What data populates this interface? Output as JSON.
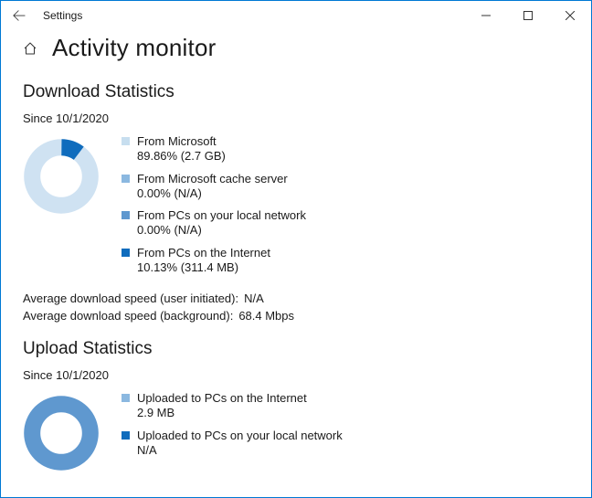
{
  "window": {
    "title": "Settings"
  },
  "page": {
    "title": "Activity monitor"
  },
  "colors": {
    "microsoft": "#c7deef",
    "cache": "#8bb8e0",
    "local": "#5f98cf",
    "internet": "#0f6cbd",
    "donut_track": "#cfe2f2",
    "donut_dark": "#0f6cbd",
    "donut_mid": "#5f98cf"
  },
  "download": {
    "section_title": "Download Statistics",
    "since": "Since 10/1/2020",
    "items": [
      {
        "label": "From Microsoft",
        "value": "89.86%  (2.7 GB)",
        "sw": "microsoft"
      },
      {
        "label": "From Microsoft cache server",
        "value": "0.00%  (N/A)",
        "sw": "cache"
      },
      {
        "label": "From PCs on your local network",
        "value": "0.00%  (N/A)",
        "sw": "local"
      },
      {
        "label": "From PCs on the Internet",
        "value": "10.13%  (311.4 MB)",
        "sw": "internet"
      }
    ],
    "avg_user_label": "Average download speed (user initiated):",
    "avg_user_value": "N/A",
    "avg_bg_label": "Average download speed (background):",
    "avg_bg_value": "68.4 Mbps"
  },
  "upload": {
    "section_title": "Upload Statistics",
    "since": "Since 10/1/2020",
    "items": [
      {
        "label": "Uploaded to PCs on the Internet",
        "value": "2.9 MB",
        "sw": "cache"
      },
      {
        "label": "Uploaded to PCs on your local network",
        "value": "N/A",
        "sw": "internet"
      }
    ]
  },
  "chart_data": [
    {
      "type": "pie",
      "title": "Download Sources",
      "series": [
        {
          "name": "From Microsoft",
          "value": 89.86,
          "size": "2.7 GB"
        },
        {
          "name": "From Microsoft cache server",
          "value": 0.0,
          "size": "N/A"
        },
        {
          "name": "From PCs on your local network",
          "value": 0.0,
          "size": "N/A"
        },
        {
          "name": "From PCs on the Internet",
          "value": 10.13,
          "size": "311.4 MB"
        }
      ]
    },
    {
      "type": "pie",
      "title": "Upload Destinations",
      "series": [
        {
          "name": "Uploaded to PCs on the Internet",
          "value": 100,
          "size": "2.9 MB"
        },
        {
          "name": "Uploaded to PCs on your local network",
          "value": 0,
          "size": "N/A"
        }
      ]
    }
  ]
}
